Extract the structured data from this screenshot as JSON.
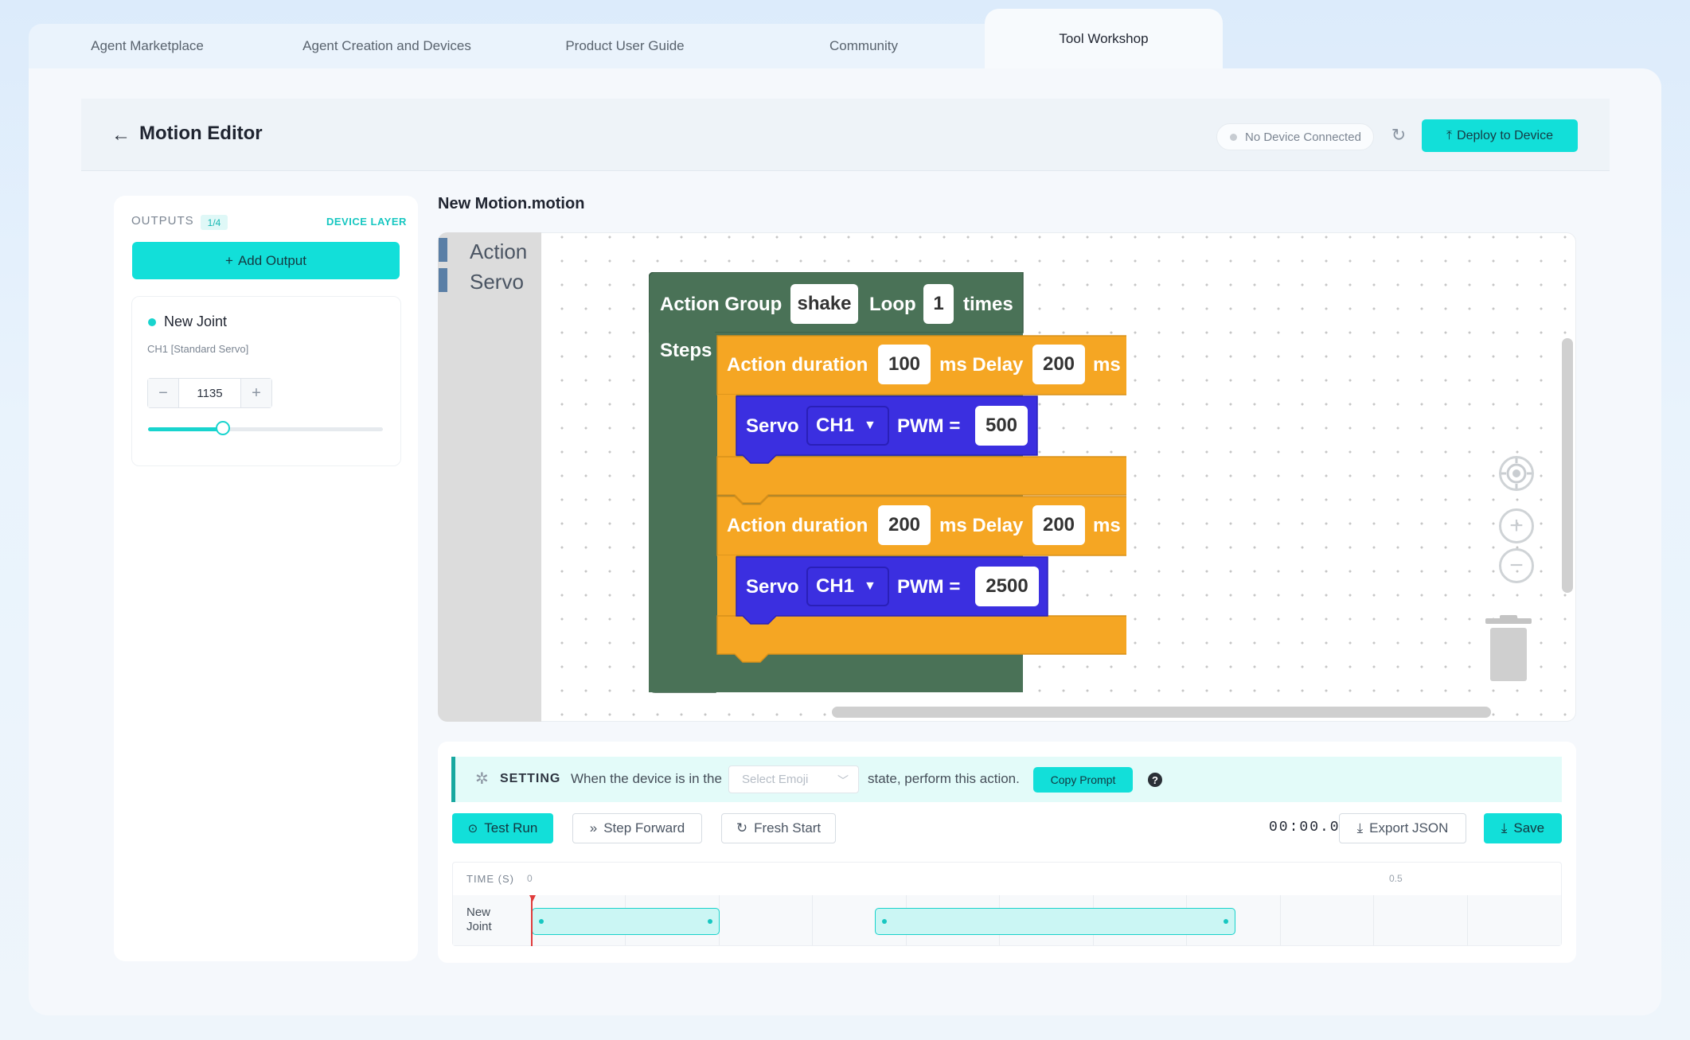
{
  "tabs": [
    "Agent Marketplace",
    "Agent Creation and Devices",
    "Product User Guide",
    "Community",
    "Tool Workshop"
  ],
  "active_tab": "Tool Workshop",
  "header": {
    "title": "Motion Editor",
    "device_status": "No Device Connected",
    "deploy_label": "Deploy to Device"
  },
  "outputs": {
    "label": "OUTPUTS",
    "count": "1/4",
    "device_layer": "DEVICE LAYER",
    "add_label": "Add Output",
    "joint": {
      "name": "New Joint",
      "channel": "CH1 [Standard Servo]",
      "value": "1135",
      "slider_fraction": 0.32
    }
  },
  "workspace": {
    "file_name": "New Motion.motion",
    "toolbox": [
      "Action",
      "Servo"
    ],
    "group": {
      "label": "Action Group",
      "name": "shake",
      "loop_label": "Loop",
      "loop_count": "1",
      "times_label": "times",
      "steps_label": "Steps"
    },
    "actions": [
      {
        "duration_label": "Action duration",
        "duration": "100",
        "ms_delay_label": "ms Delay",
        "delay": "200",
        "ms_label": "ms",
        "servo_label": "Servo",
        "channel": "CH1",
        "pwm_label": "PWM =",
        "pwm": "500"
      },
      {
        "duration_label": "Action duration",
        "duration": "200",
        "ms_delay_label": "ms Delay",
        "delay": "200",
        "ms_label": "ms",
        "servo_label": "Servo",
        "channel": "CH1",
        "pwm_label": "PWM =",
        "pwm": "2500"
      }
    ]
  },
  "setting": {
    "label": "SETTING",
    "text_before": "When the device is in the",
    "emoji_placeholder": "Select Emoji",
    "text_after": "state, perform this action.",
    "copy_prompt": "Copy Prompt",
    "help": "?"
  },
  "controls": {
    "test_run": "Test Run",
    "step_forward": "Step Forward",
    "fresh_start": "Fresh Start",
    "timer": "00:00.0",
    "export": "Export JSON",
    "save": "Save"
  },
  "timeline": {
    "header": "TIME (S)",
    "tick_start": "0",
    "tick_mid": "0.5",
    "row_label_1": "New",
    "row_label_2": "Joint"
  },
  "colors": {
    "accent": "#12dfd9",
    "action_group": "#4a7257",
    "action_block": "#f5a623",
    "servo_block": "#3b2fe0"
  }
}
